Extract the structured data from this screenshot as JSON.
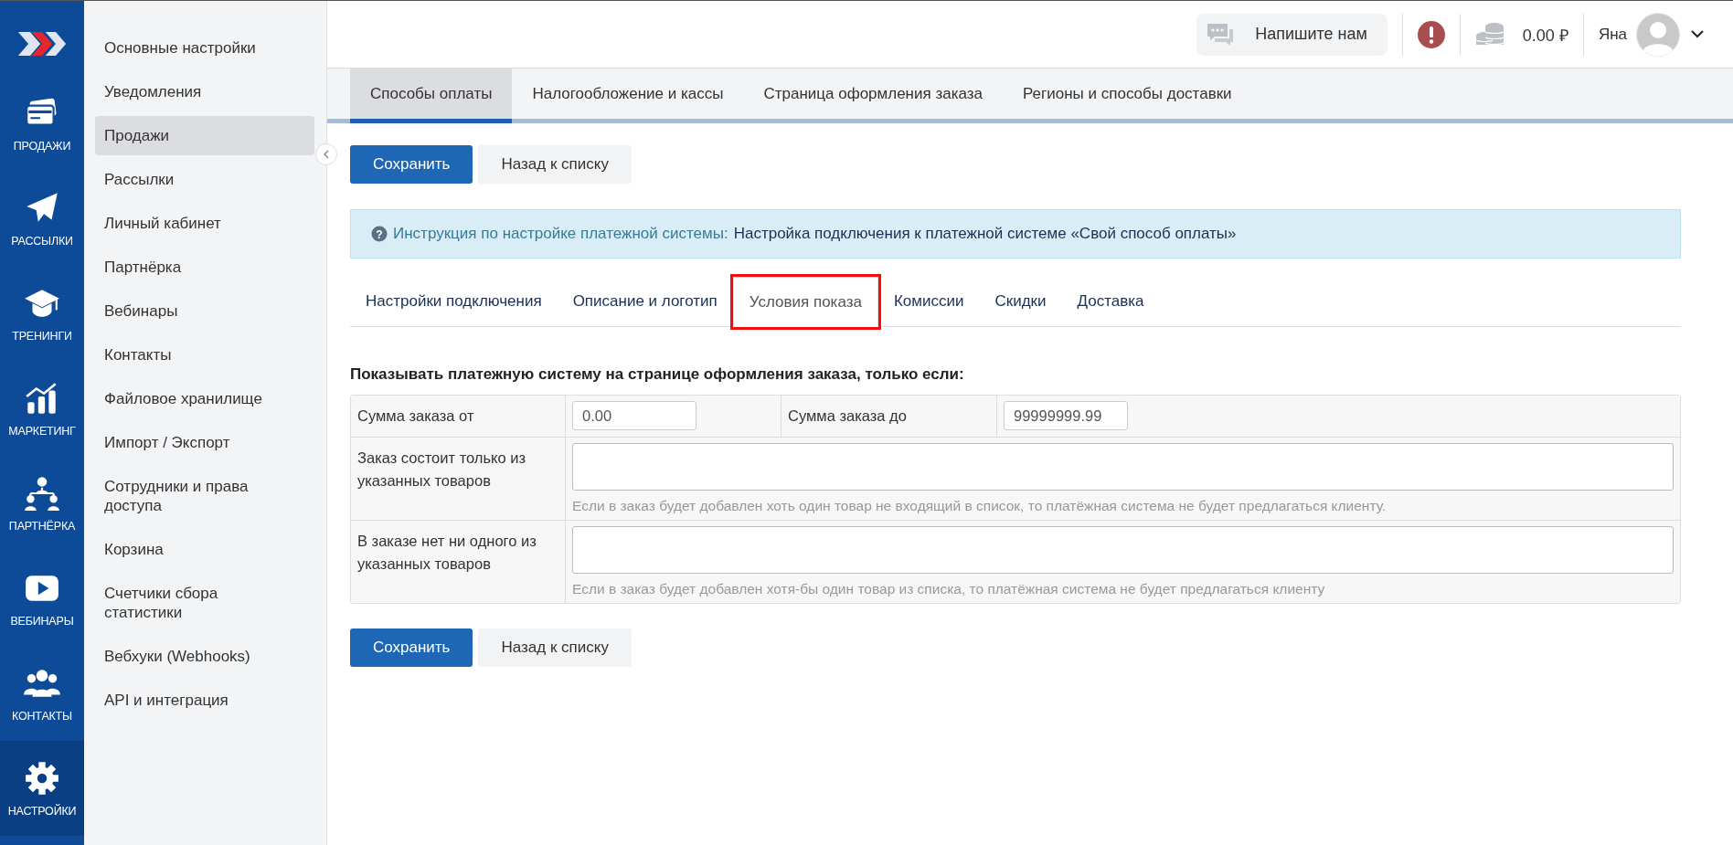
{
  "rail": [
    {
      "label": "ПРОДАЖИ",
      "selected": false
    },
    {
      "label": "РАССЫЛКИ",
      "selected": false
    },
    {
      "label": "ТРЕНИНГИ",
      "selected": false
    },
    {
      "label": "МАРКЕТИНГ",
      "selected": false
    },
    {
      "label": "ПАРТНЁРКА",
      "selected": false
    },
    {
      "label": "ВЕБИНАРЫ",
      "selected": false
    },
    {
      "label": "КОНТАКТЫ",
      "selected": false
    },
    {
      "label": "НАСТРОЙКИ",
      "selected": true
    }
  ],
  "sidebar": {
    "items": [
      {
        "label": "Основные настройки",
        "selected": false
      },
      {
        "label": "Уведомления",
        "selected": false
      },
      {
        "label": "Продажи",
        "selected": true
      },
      {
        "label": "Рассылки",
        "selected": false
      },
      {
        "label": "Личный кабинет",
        "selected": false
      },
      {
        "label": "Партнёрка",
        "selected": false
      },
      {
        "label": "Вебинары",
        "selected": false
      },
      {
        "label": "Контакты",
        "selected": false
      },
      {
        "label": "Файловое хранилище",
        "selected": false
      },
      {
        "label": "Импорт / Экспорт",
        "selected": false
      },
      {
        "label": "Сотрудники и права доступа",
        "selected": false
      },
      {
        "label": "Корзина",
        "selected": false
      },
      {
        "label": "Счетчики сбора статистики",
        "selected": false
      },
      {
        "label": "Вебхуки (Webhooks)",
        "selected": false
      },
      {
        "label": "API и интеграция",
        "selected": false
      }
    ]
  },
  "header": {
    "chat_button": "Напишите нам",
    "balance": "0.00 ₽",
    "user": "Яна"
  },
  "tabs": [
    {
      "label": "Способы оплаты",
      "selected": true
    },
    {
      "label": "Налогообложение и кассы",
      "selected": false
    },
    {
      "label": "Страница оформления заказа",
      "selected": false
    },
    {
      "label": "Регионы и способы доставки",
      "selected": false
    }
  ],
  "buttons_top": {
    "save": "Сохранить",
    "back": "Назад к списку"
  },
  "info": {
    "icon_text": "?",
    "label": "Инструкция по настройке платежной системы:",
    "link": "Настройка подключения к платежной системе «Свой способ оплаты»"
  },
  "subtabs": [
    {
      "label": "Настройки подключения",
      "selected": false,
      "highlighted": false
    },
    {
      "label": "Описание и логотип",
      "selected": false,
      "highlighted": false
    },
    {
      "label": "Условия показа",
      "selected": true,
      "highlighted": true
    },
    {
      "label": "Комиссии",
      "selected": false,
      "highlighted": false
    },
    {
      "label": "Скидки",
      "selected": false,
      "highlighted": false
    },
    {
      "label": "Доставка",
      "selected": false,
      "highlighted": false
    }
  ],
  "form": {
    "heading": "Показывать платежную систему на странице оформления заказа, только если:",
    "sum_from": {
      "label": "Сумма заказа от",
      "value": "0.00"
    },
    "sum_to": {
      "label": "Сумма заказа до",
      "value": "99999999.99"
    },
    "rows": [
      {
        "label": "Заказ состоит только из указанных товаров",
        "hint": "Если в заказ будет добавлен хоть один товар не входящий в список, то платёжная система не будет предлагаться клиенту."
      },
      {
        "label": "В заказе нет ни одного из указанных товаров",
        "hint": "Если в заказ будет добавлен хотя-бы один товар из списка, то платёжная система не будет предлагаться клиенту"
      }
    ]
  },
  "buttons_bottom": {
    "save": "Сохранить",
    "back": "Назад к списку"
  }
}
